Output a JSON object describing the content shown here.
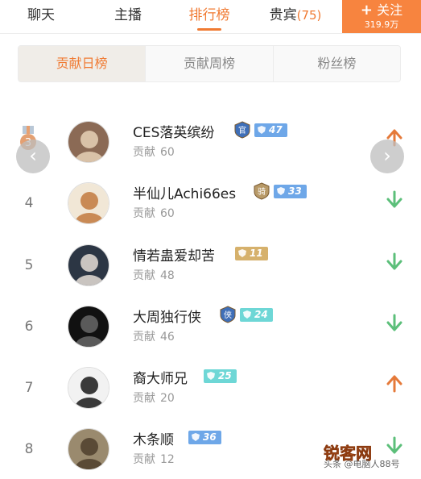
{
  "tabs": [
    {
      "label": "聊天"
    },
    {
      "label": "主播"
    },
    {
      "label": "排行榜"
    },
    {
      "label": "贵宾",
      "count": "(75)"
    }
  ],
  "follow": {
    "plus": "+",
    "label": "关注",
    "fans": "319.9万",
    "color": "#f7843f"
  },
  "segments": [
    {
      "label": "贡献日榜"
    },
    {
      "label": "贡献周榜"
    },
    {
      "label": "粉丝榜"
    }
  ],
  "contrib_label": "贡献",
  "nav": {
    "prev": "‹",
    "next": "›"
  },
  "rows": [
    {
      "rank": "3",
      "name": "CES落英缤纷",
      "role": "官",
      "level": "47",
      "level_style": "blue",
      "contribution": "60",
      "trend": "up"
    },
    {
      "rank": "4",
      "name": "半仙儿Achi66es",
      "role": "骑",
      "level": "33",
      "level_style": "blue",
      "contribution": "60",
      "trend": "down"
    },
    {
      "rank": "5",
      "name": "情若蛊爱却苦",
      "role": "",
      "level": "11",
      "level_style": "gold",
      "contribution": "48",
      "trend": "down"
    },
    {
      "rank": "6",
      "name": "大周独行侠",
      "role": "侠",
      "level": "24",
      "level_style": "teal",
      "contribution": "46",
      "trend": "down"
    },
    {
      "rank": "7",
      "name": "裔大师兄",
      "role": "",
      "level": "25",
      "level_style": "teal",
      "contribution": "20",
      "trend": "up"
    },
    {
      "rank": "8",
      "name": "木条顺",
      "role": "",
      "level": "36",
      "level_style": "blue",
      "contribution": "12",
      "trend": "down"
    }
  ],
  "watermark": {
    "logo": "锐客网",
    "sub": "头条 @电脑人88号"
  },
  "colors": {
    "accent": "#f07a32",
    "up": "#e57a3a",
    "down": "#5cbf7a"
  }
}
